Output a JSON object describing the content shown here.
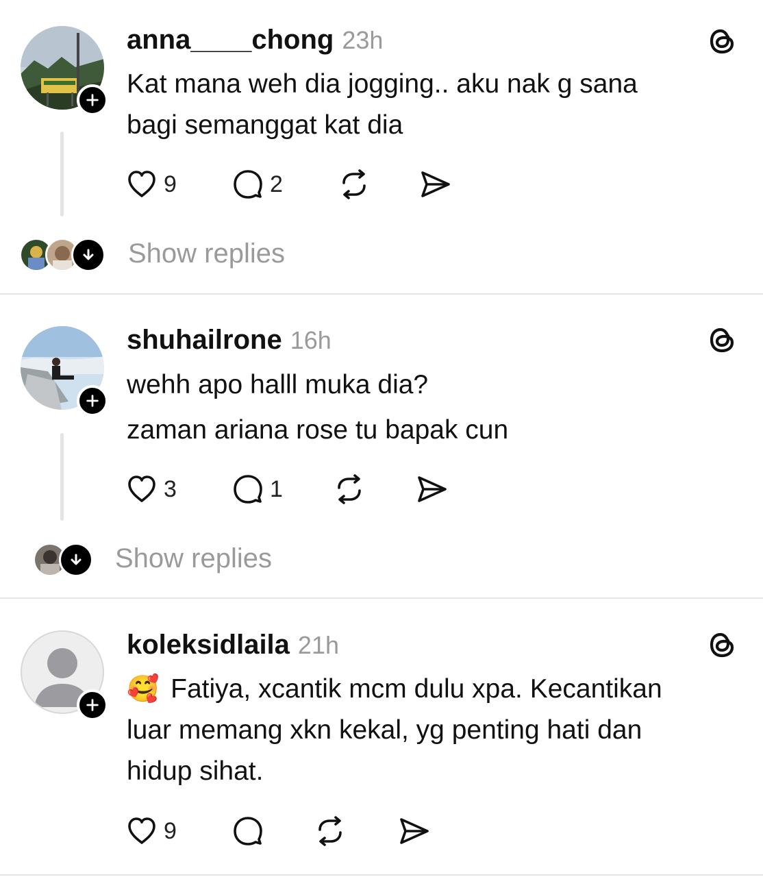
{
  "comments": [
    {
      "username": "anna____chong",
      "time": "23h",
      "lines": [
        "Kat mana weh dia jogging.. aku nak g sana",
        "bagi semanggat kat dia"
      ],
      "likes": "9",
      "replies": "2",
      "show_replies": "Show replies"
    },
    {
      "username": "shuhailrone",
      "time": "16h",
      "lines": [
        "wehh apo halll muka dia?",
        "zaman ariana rose tu bapak cun"
      ],
      "likes": "3",
      "replies": "1",
      "show_replies": "Show replies"
    },
    {
      "username": "koleksidlaila",
      "time": "21h",
      "emoji": "🥰",
      "lines": [
        "Fatiya, xcantik mcm dulu xpa. Kecantikan",
        "luar memang xkn kekal, yg penting hati dan",
        "hidup sihat."
      ],
      "likes": "9"
    }
  ]
}
